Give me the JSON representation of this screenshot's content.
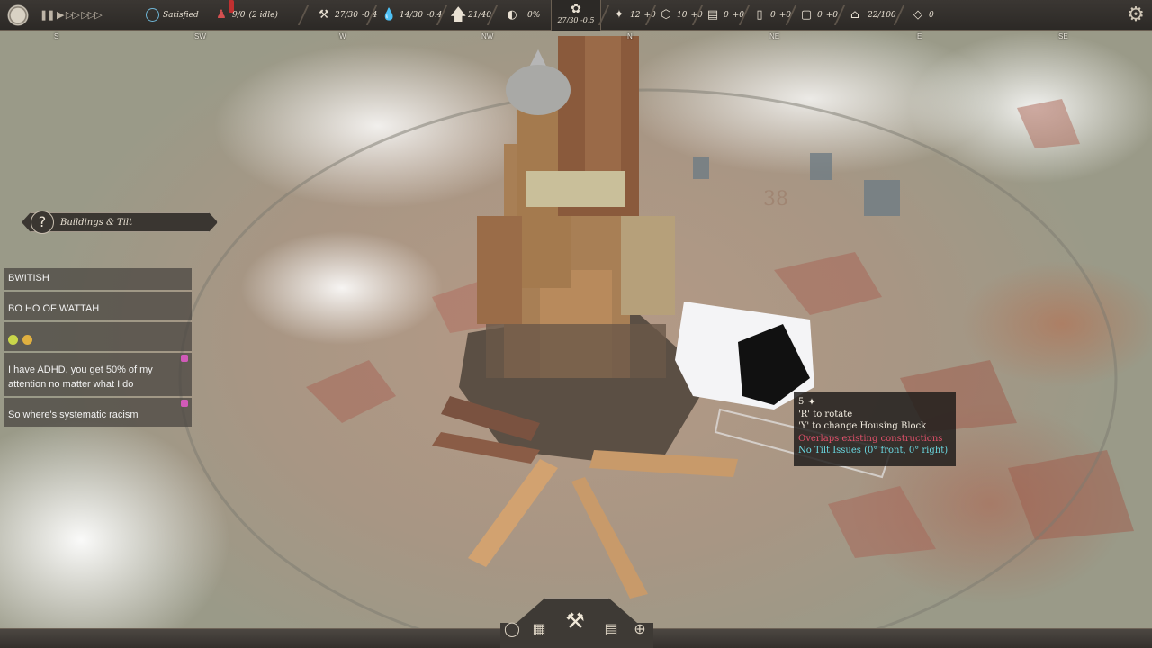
{
  "topbar": {
    "approval": "Satisfied",
    "population": "9/0",
    "idle": "(2 idle)",
    "resources": [
      {
        "icon": "pickaxe-icon",
        "value": "27/30",
        "rate": "-0.4"
      },
      {
        "icon": "water-drop-icon",
        "value": "14/30",
        "rate": "-0.4"
      },
      {
        "icon": "up-arrow-icon",
        "value": "21/40",
        "rate": ""
      },
      {
        "icon": "gauge-icon",
        "value": "0%",
        "rate": ""
      },
      {
        "icon": "stone-icon",
        "value": "12",
        "rate": "+0"
      },
      {
        "icon": "block-icon",
        "value": "10",
        "rate": "+0"
      },
      {
        "icon": "stack-icon",
        "value": "0",
        "rate": "+0"
      },
      {
        "icon": "panel-icon",
        "value": "0",
        "rate": "+0"
      },
      {
        "icon": "frame-icon",
        "value": "0",
        "rate": "+0"
      },
      {
        "icon": "storage-icon",
        "value": "22/100",
        "rate": ""
      },
      {
        "icon": "diamond-icon",
        "value": "0",
        "rate": ""
      }
    ],
    "center": {
      "value": "27/30",
      "rate": "-0.5"
    }
  },
  "compass": [
    "S",
    "SW",
    "W",
    "NW",
    "N",
    "NE",
    "E",
    "SE"
  ],
  "objective": {
    "label": "Buildings & Tilt"
  },
  "chat": [
    {
      "user": "",
      "text": "BWITISH",
      "heart": false
    },
    {
      "user": "user",
      "text": "BO HO OF WATTAH",
      "heart": false
    },
    {
      "user": "user",
      "text": "",
      "emotes": true,
      "heart": false
    },
    {
      "user": "user",
      "text": "I have ADHD, you get 50% of my attention no matter what I do",
      "heart": true
    },
    {
      "user": "user",
      "text": "So where's systematic racism",
      "heart": true
    }
  ],
  "tooltip": {
    "cost": "5",
    "rotate": "'R' to rotate",
    "change": "'Y' to change Housing Block",
    "overlap": "Overlaps existing constructions",
    "tilt": "No Tilt Issues (0° front, 0° right)"
  },
  "colors": {
    "topbar": "#2c2926",
    "warning": "#e0506a",
    "ok": "#6ad7e0",
    "chat_bg": "#46423e"
  }
}
